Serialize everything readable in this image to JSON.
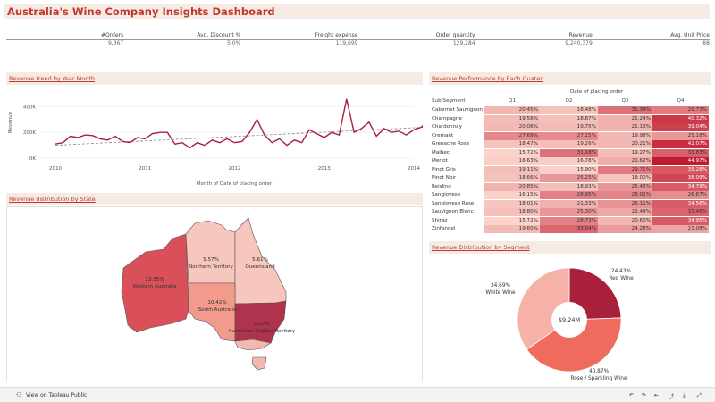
{
  "title": "Australia's Wine Company Insights Dashboard",
  "kpis": {
    "headers": [
      "#Orders",
      "Avg. Discount %",
      "Freight expense",
      "Order quantity",
      "Revenue",
      "Avg. Unit Price"
    ],
    "values": [
      "9,367",
      "5.0%",
      "119,699",
      "129,284",
      "9,240,379",
      "88"
    ]
  },
  "trend": {
    "panel_title": "Revenue trend by Year Month",
    "ylabel": "Revenue",
    "xlabel": "Month of Date of placing order",
    "y_ticks": [
      "400K",
      "200K",
      "0K"
    ],
    "x_ticks": [
      "2010",
      "2011",
      "2012",
      "2013",
      "2014"
    ]
  },
  "chart_data": [
    {
      "type": "line",
      "title": "Revenue trend by Year Month",
      "xlabel": "Month of Date of placing order",
      "ylabel": "Revenue",
      "ylim": [
        0,
        500000
      ],
      "x_range": [
        "2010-01",
        "2014-01"
      ],
      "series": [
        {
          "values": [
            110000,
            120000,
            170000,
            160000,
            180000,
            175000,
            150000,
            140000,
            170000,
            130000,
            120000,
            160000,
            150000,
            190000,
            200000,
            200000,
            110000,
            120000,
            80000,
            120000,
            100000,
            140000,
            120000,
            150000,
            120000,
            130000,
            200000,
            300000,
            180000,
            120000,
            150000,
            100000,
            140000,
            120000,
            220000,
            190000,
            160000,
            200000,
            180000,
            460000,
            200000,
            230000,
            280000,
            170000,
            230000,
            200000,
            210000,
            180000,
            220000,
            240000,
            300000,
            360000,
            350000,
            290000
          ]
        },
        {
          "name": "trend",
          "values_start_end": [
            100000,
            250000
          ]
        }
      ]
    },
    {
      "type": "heatmap",
      "title": "Revenue Performance by Each Quater",
      "column_group_label": "Date of placing order",
      "row_header": "Sub Segment",
      "columns": [
        "Q1",
        "Q2",
        "Q3",
        "Q4"
      ],
      "rows": [
        {
          "name": "Cabernet Sauvignon",
          "values": [
            20.45,
            18.48,
            31.34,
            29.73
          ]
        },
        {
          "name": "Champagne",
          "values": [
            19.58,
            18.87,
            21.24,
            40.32
          ]
        },
        {
          "name": "Chardonnay",
          "values": [
            20.08,
            19.75,
            21.13,
            39.04
          ]
        },
        {
          "name": "Cremant",
          "values": [
            27.69,
            27.15,
            19.98,
            25.18
          ]
        },
        {
          "name": "Grenache Rose",
          "values": [
            18.47,
            19.26,
            20.21,
            42.07
          ]
        },
        {
          "name": "Malbec",
          "values": [
            15.72,
            31.18,
            19.27,
            33.83
          ]
        },
        {
          "name": "Merlot",
          "values": [
            16.63,
            16.78,
            21.62,
            44.97
          ]
        },
        {
          "name": "Pinot Gris",
          "values": [
            19.11,
            15.9,
            29.71,
            35.28
          ]
        },
        {
          "name": "Pinot Noir",
          "values": [
            18.66,
            25.25,
            18.0,
            38.09
          ]
        },
        {
          "name": "Reisling",
          "values": [
            20.85,
            18.93,
            25.43,
            34.79
          ]
        },
        {
          "name": "Sangiovese",
          "values": [
            16.15,
            28.95,
            28.02,
            26.87
          ]
        },
        {
          "name": "Sangiovese Rose",
          "values": [
            18.01,
            21.33,
            26.11,
            34.56
          ]
        },
        {
          "name": "Sauvignon Blanc",
          "values": [
            18.8,
            25.3,
            22.44,
            33.46
          ]
        },
        {
          "name": "Shiraz",
          "values": [
            15.72,
            28.73,
            20.6,
            34.95
          ]
        },
        {
          "name": "Zinfandel",
          "values": [
            19.6,
            33.04,
            24.28,
            23.08
          ]
        }
      ]
    },
    {
      "type": "pie",
      "title": "Revenue Distribution by Segment",
      "center_label": "$9.24M",
      "slices": [
        {
          "name": "Red Wine",
          "value": 24.43,
          "label": "24.43%",
          "color": "#a8203a"
        },
        {
          "name": "Rose / Sparkling Wine",
          "value": 40.87,
          "label": "40.87%",
          "color": "#ee6b5e"
        },
        {
          "name": "White Wine",
          "value": 34.69,
          "label": "34.69%",
          "color": "#f6b2a8"
        }
      ]
    }
  ],
  "heatmap_text": {
    "panel_title": "Revenue Performance by Each Quater",
    "group_label": "Date of placing order",
    "row_header": "Sub Segment"
  },
  "map": {
    "panel_title": "Revenue distribution by State",
    "states": [
      {
        "name": "Western Australia",
        "pct": "23.55%",
        "color": "#d9505a"
      },
      {
        "name": "Northern Territory",
        "pct": "5.57%",
        "color": "#f7c6bd"
      },
      {
        "name": "Queensland",
        "pct": "5.61%",
        "color": "#f7c6bd"
      },
      {
        "name": "South Australia",
        "pct": "10.42%",
        "color": "#f29a8c"
      },
      {
        "name": "Australian Capital Territory",
        "pct": "9.02%",
        "color": "#b0334e"
      }
    ]
  },
  "pie_text": {
    "panel_title": "Revenue Distribution by Segment"
  },
  "footer": {
    "view_on": "View on Tableau Public"
  },
  "colors": {
    "accent": "#c0392b",
    "panel_bg": "#f6ebe4",
    "trend_line": "#a8203a"
  }
}
